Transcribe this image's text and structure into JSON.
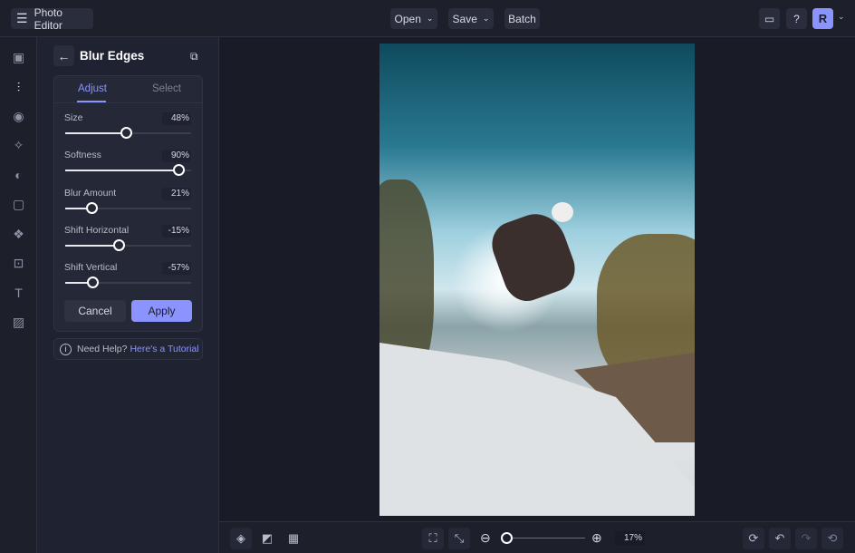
{
  "app": {
    "title": "Photo Editor"
  },
  "topbar": {
    "open": "Open",
    "save": "Save",
    "batch": "Batch",
    "avatar": "R"
  },
  "panel": {
    "title": "Blur Edges",
    "tabs": [
      "Adjust",
      "Select"
    ],
    "sliders": [
      {
        "label": "Size",
        "value": "48%",
        "fraction": 0.48
      },
      {
        "label": "Softness",
        "value": "90%",
        "fraction": 0.9
      },
      {
        "label": "Blur Amount",
        "value": "21%",
        "fraction": 0.21
      },
      {
        "label": "Shift Horizontal",
        "value": "-15%",
        "fraction": 0.425
      },
      {
        "label": "Shift Vertical",
        "value": "-57%",
        "fraction": 0.215
      }
    ],
    "cancel": "Cancel",
    "apply": "Apply",
    "help_text": "Need Help?",
    "help_link": "Here's a Tutorial"
  },
  "zoom": {
    "value": "17%",
    "fraction": 0.0
  },
  "colors": {
    "accent": "#8b93ff",
    "link": "#8b93ff"
  }
}
